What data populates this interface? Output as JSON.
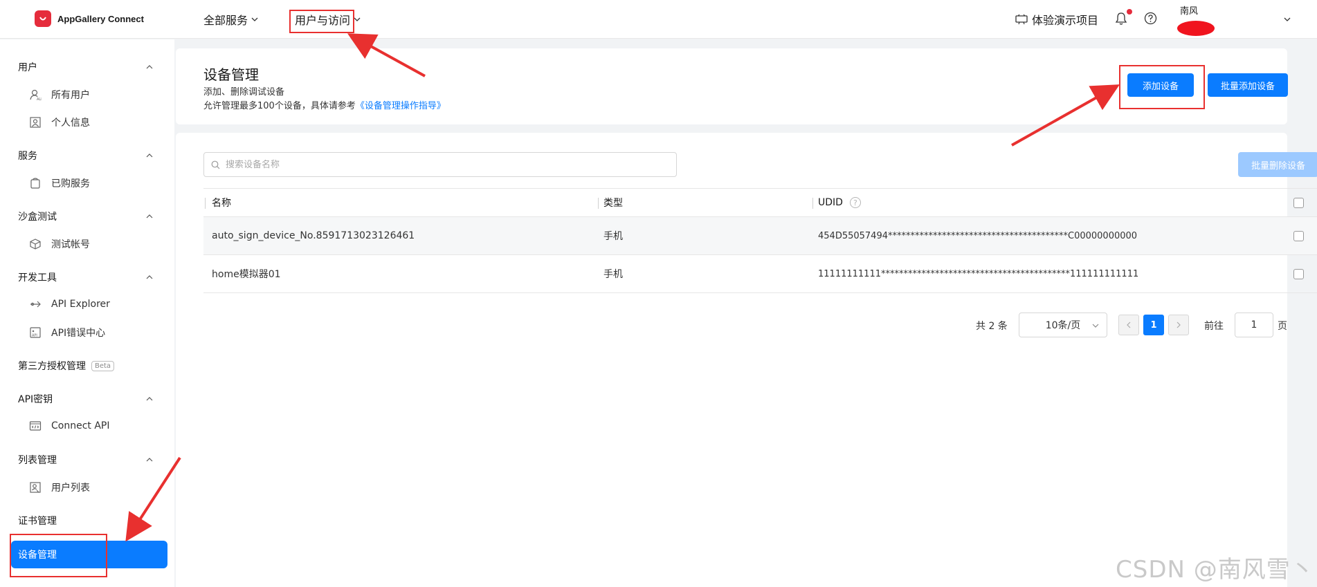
{
  "app": {
    "name": "AppGallery Connect",
    "brand_color": "#e52c3c",
    "accent_color": "#0a7cff"
  },
  "topnav": {
    "all_services": "全部服务",
    "user_access": "用户与访问",
    "demo_project": "体验演示项目",
    "user_name": "南风"
  },
  "sidebar": {
    "groups": [
      {
        "label": "用户",
        "items": [
          {
            "label": "所有用户",
            "icon": "user-all-icon"
          },
          {
            "label": "个人信息",
            "icon": "profile-icon"
          }
        ]
      },
      {
        "label": "服务",
        "items": [
          {
            "label": "已购服务",
            "icon": "bag-icon"
          }
        ]
      },
      {
        "label": "沙盒测试",
        "items": [
          {
            "label": "测试帐号",
            "icon": "cube-icon"
          }
        ]
      },
      {
        "label": "开发工具",
        "items": [
          {
            "label": "API Explorer",
            "icon": "api-explorer-icon"
          },
          {
            "label": "API错误中心",
            "icon": "api-error-icon"
          }
        ]
      },
      {
        "label": "第三方授权管理",
        "badge": "Beta"
      },
      {
        "label": "API密钥",
        "items": [
          {
            "label": "Connect API",
            "icon": "code-window-icon"
          }
        ]
      },
      {
        "label": "列表管理",
        "items": [
          {
            "label": "用户列表",
            "icon": "user-list-icon"
          }
        ]
      },
      {
        "label": "证书管理"
      },
      {
        "label": "设备管理",
        "active": true
      }
    ]
  },
  "header": {
    "title": "设备管理",
    "desc1": "添加、删除调试设备",
    "desc2_prefix": "允许管理最多100个设备，具体请参考",
    "desc2_link": "《设备管理操作指导》",
    "add_button": "添加设备",
    "batch_add_button": "批量添加设备"
  },
  "main": {
    "search_placeholder": "搜索设备名称",
    "batch_delete_button": "批量删除设备",
    "columns": [
      "名称",
      "类型",
      "UDID"
    ],
    "rows": [
      {
        "name": "auto_sign_device_No.8591713023126461",
        "type": "手机",
        "udid": "454D55057494****************************************C00000000000"
      },
      {
        "name": "home模拟器01",
        "type": "手机",
        "udid": "11111111111******************************************111111111111"
      }
    ]
  },
  "pagination": {
    "total": "共 2 条",
    "page_size": "10条/页",
    "current_page": "1",
    "goto_label": "前往",
    "goto_value": "1",
    "page_suffix": "页"
  },
  "watermark": "CSDN @南风雪丶"
}
